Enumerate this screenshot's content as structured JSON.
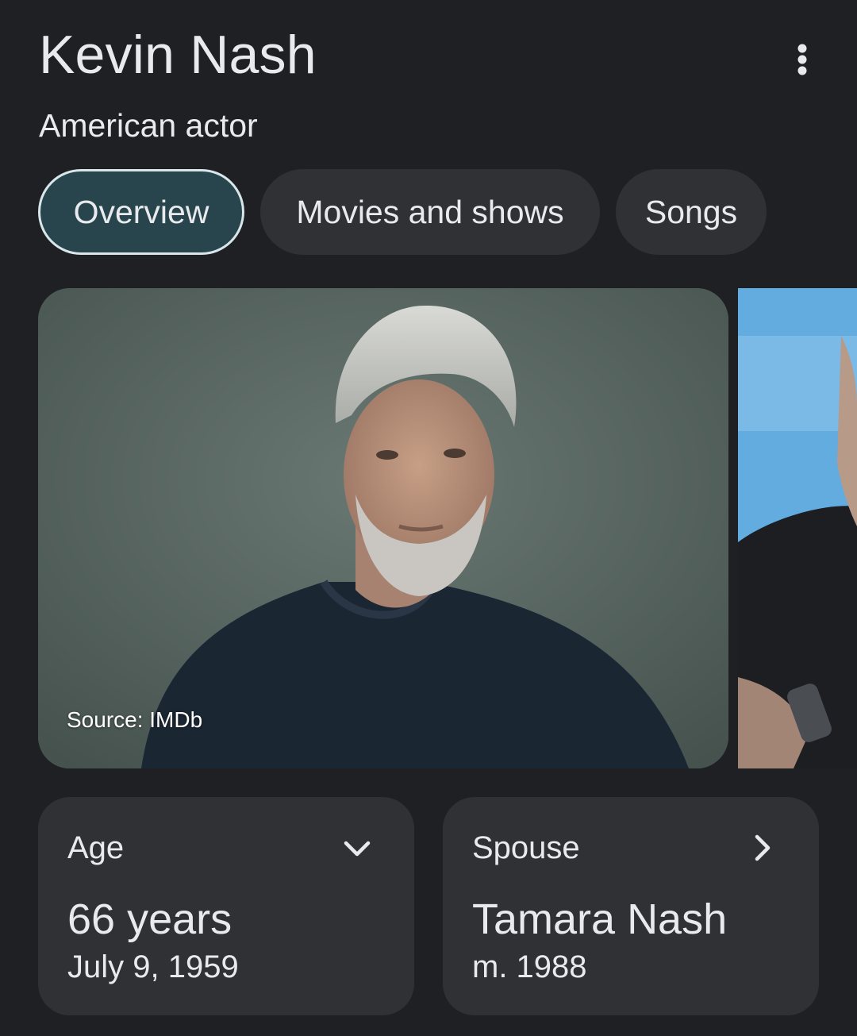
{
  "header": {
    "title": "Kevin Nash",
    "subtitle": "American actor",
    "menu_icon": "more-vert-icon"
  },
  "tabs": [
    {
      "label": "Overview",
      "active": true
    },
    {
      "label": "Movies and shows",
      "active": false
    },
    {
      "label": "Songs",
      "active": false
    }
  ],
  "images": {
    "main_source": "Source: IMDb"
  },
  "cards": {
    "age": {
      "label": "Age",
      "value": "66 years",
      "sub": "July 9, 1959",
      "icon": "chevron-down-icon"
    },
    "spouse": {
      "label": "Spouse",
      "value": "Tamara Nash",
      "sub": "m. 1988",
      "icon": "chevron-right-icon"
    }
  },
  "colors": {
    "background": "#1f2023",
    "chip": "#303134",
    "active_chip": "#28454d",
    "text": "#e8eaed"
  }
}
